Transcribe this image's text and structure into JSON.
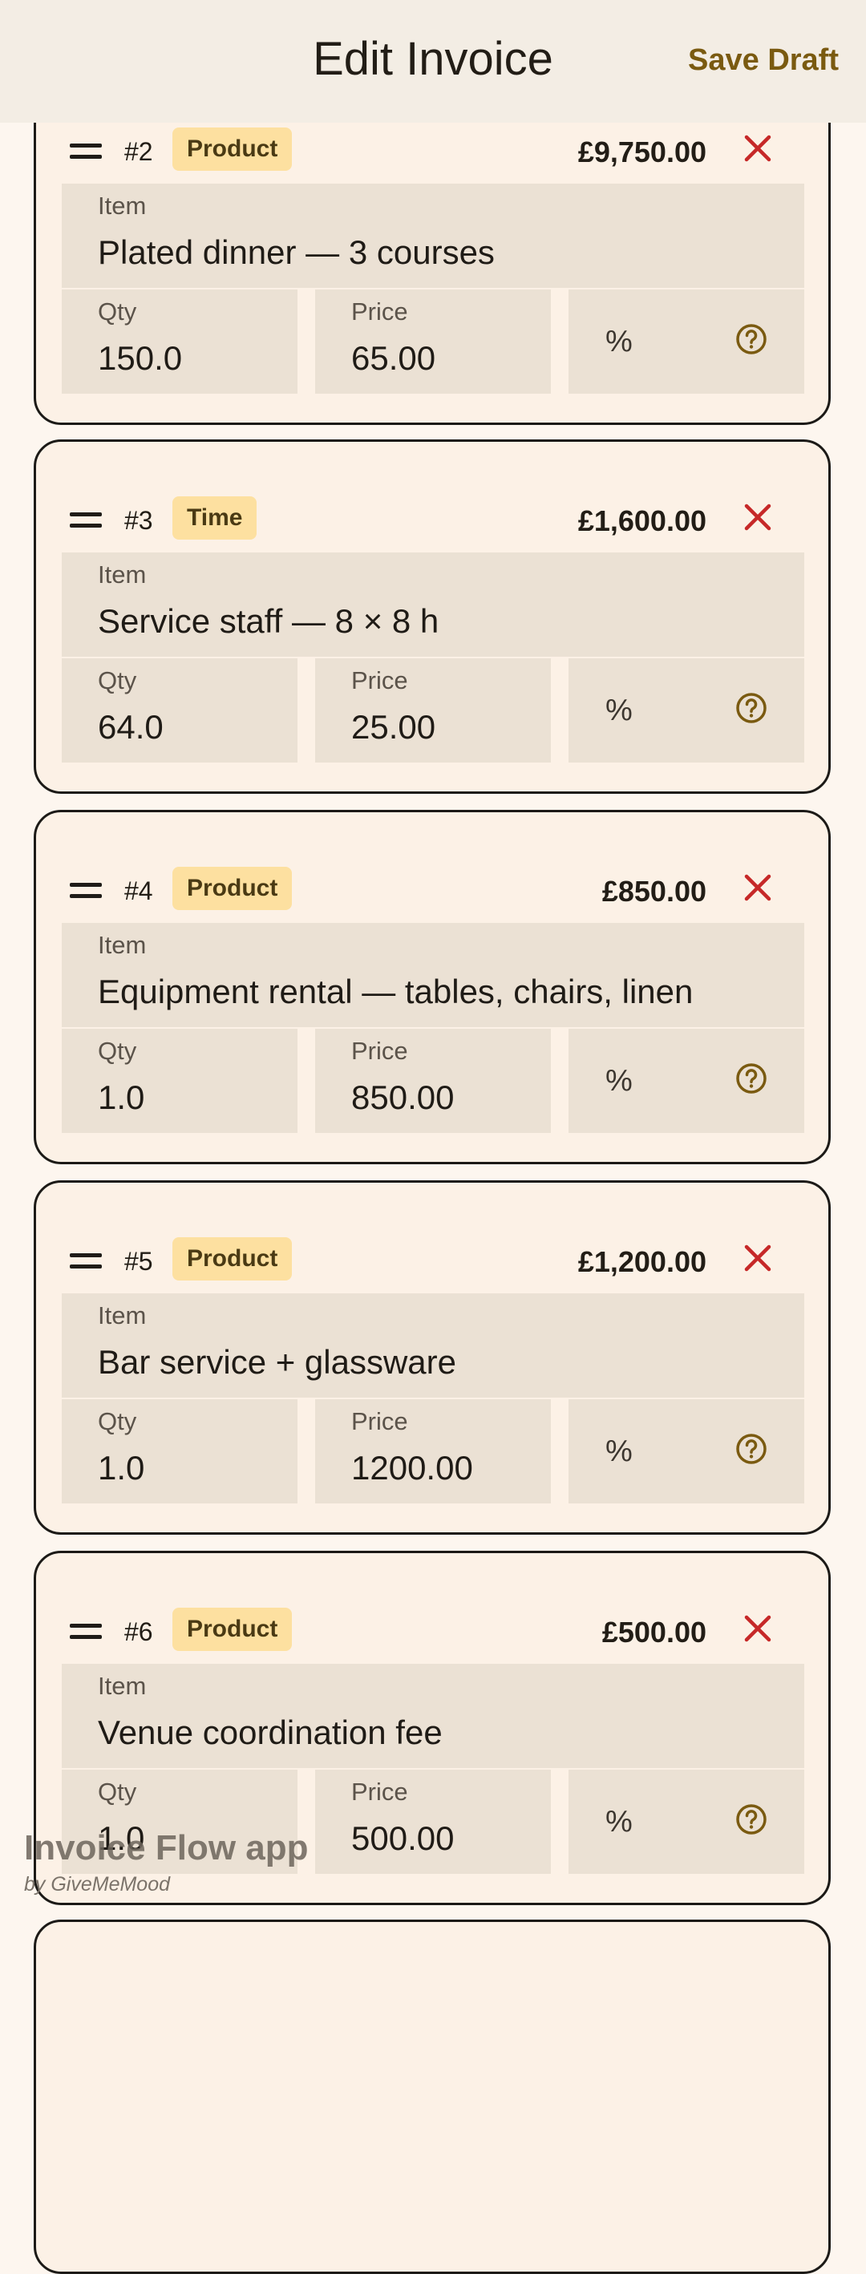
{
  "header": {
    "title": "Edit Invoice",
    "save_draft": "Save Draft"
  },
  "colors": {
    "accent": "#7a5a10",
    "delete": "#c62828",
    "badge": "#fde0a0",
    "field_bg": "#ebe1d4",
    "card_bg": "#fcf1e6"
  },
  "field_labels": {
    "item": "Item",
    "qty": "Qty",
    "price": "Price",
    "percent": "%"
  },
  "items": [
    {
      "number": "#2",
      "type": "Product",
      "total": "£9,750.00",
      "item": "Plated dinner — 3 courses",
      "qty": "150.0",
      "price": "65.00"
    },
    {
      "number": "#3",
      "type": "Time",
      "total": "£1,600.00",
      "item": "Service staff — 8 × 8 h",
      "qty": "64.0",
      "price": "25.00"
    },
    {
      "number": "#4",
      "type": "Product",
      "total": "£850.00",
      "item": "Equipment rental — tables, chairs, linen",
      "qty": "1.0",
      "price": "850.00"
    },
    {
      "number": "#5",
      "type": "Product",
      "total": "£1,200.00",
      "item": "Bar service + glassware",
      "qty": "1.0",
      "price": "1200.00"
    },
    {
      "number": "#6",
      "type": "Product",
      "total": "£500.00",
      "item": "Venue coordination fee",
      "qty": "1.0",
      "price": "500.00"
    }
  ],
  "watermark": {
    "title": "Invoice Flow app",
    "byline": "by GiveMeMood"
  }
}
